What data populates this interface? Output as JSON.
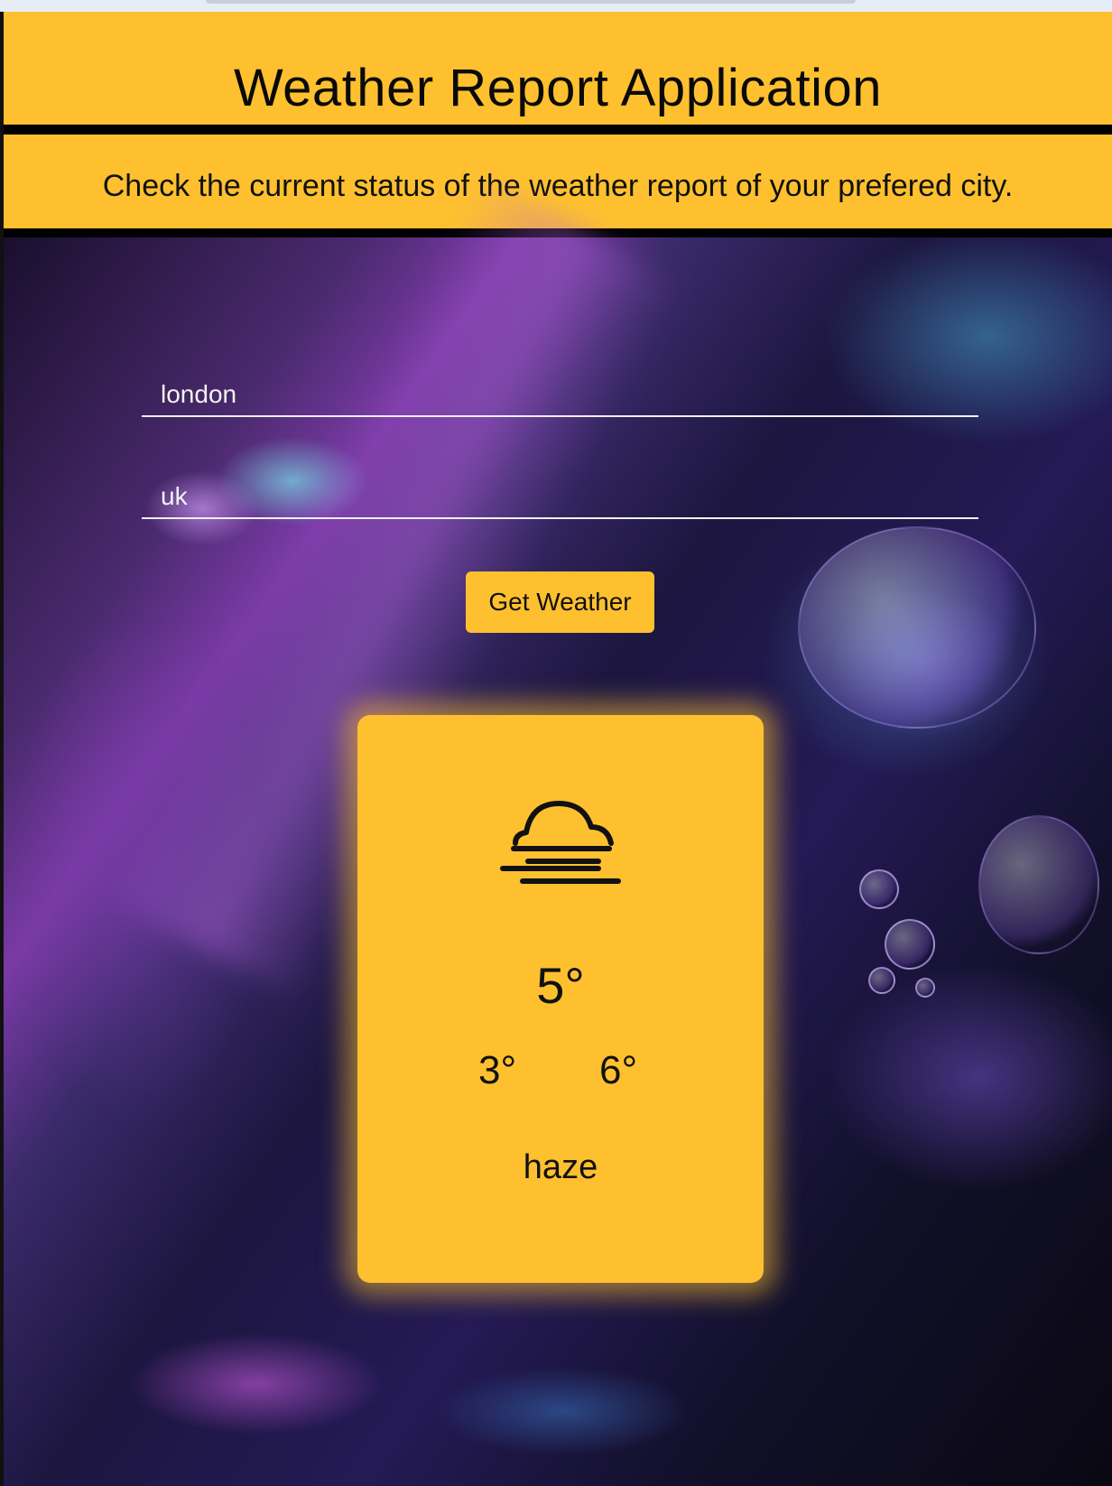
{
  "header": {
    "title": "Weather Report Application",
    "subtitle": "Check the current status of the weather report of your prefered city."
  },
  "form": {
    "city_value": "london",
    "country_value": "uk",
    "submit_label": "Get Weather"
  },
  "weather_card": {
    "icon": "haze-icon",
    "temperature": "5°",
    "temp_min": "3°",
    "temp_max": "6°",
    "condition": "haze"
  },
  "colors": {
    "accent": "#fec02f",
    "text_dark": "#111111",
    "input_text": "#f2f2f2"
  }
}
